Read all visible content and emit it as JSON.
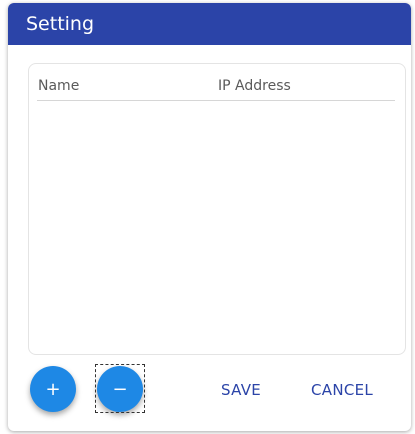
{
  "dialog": {
    "title": "Setting",
    "accent_color": "#2b44a8",
    "fab_color": "#1e88e5"
  },
  "table": {
    "columns": [
      "Name",
      "IP Address"
    ],
    "rows": []
  },
  "actions": {
    "add_label": "+",
    "remove_label": "−",
    "save_label": "SAVE",
    "cancel_label": "CANCEL"
  }
}
